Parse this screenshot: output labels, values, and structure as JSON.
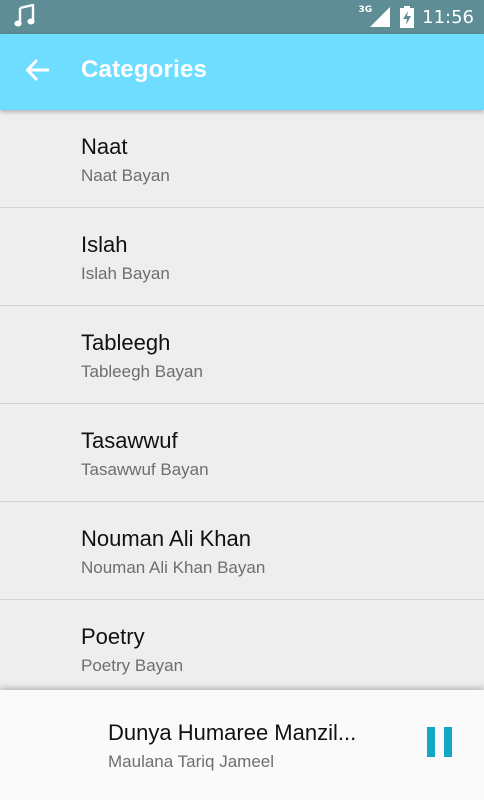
{
  "status_bar": {
    "network": "3G",
    "time": "11:56"
  },
  "app_bar": {
    "title": "Categories"
  },
  "categories": [
    {
      "title": "Naat",
      "subtitle": "Naat Bayan"
    },
    {
      "title": "Islah",
      "subtitle": "Islah Bayan"
    },
    {
      "title": "Tableegh",
      "subtitle": "Tableegh Bayan"
    },
    {
      "title": "Tasawwuf",
      "subtitle": "Tasawwuf Bayan"
    },
    {
      "title": "Nouman Ali Khan",
      "subtitle": "Nouman Ali Khan Bayan"
    },
    {
      "title": "Poetry",
      "subtitle": "Poetry Bayan"
    }
  ],
  "player": {
    "track_title": "Dunya Humaree Manzil...",
    "artist": "Maulana Tariq Jameel",
    "state_icon": "pause-icon"
  },
  "colors": {
    "status_bar": "#5E8D96",
    "app_bar": "#6FDDFF",
    "accent": "#13A9C4"
  }
}
